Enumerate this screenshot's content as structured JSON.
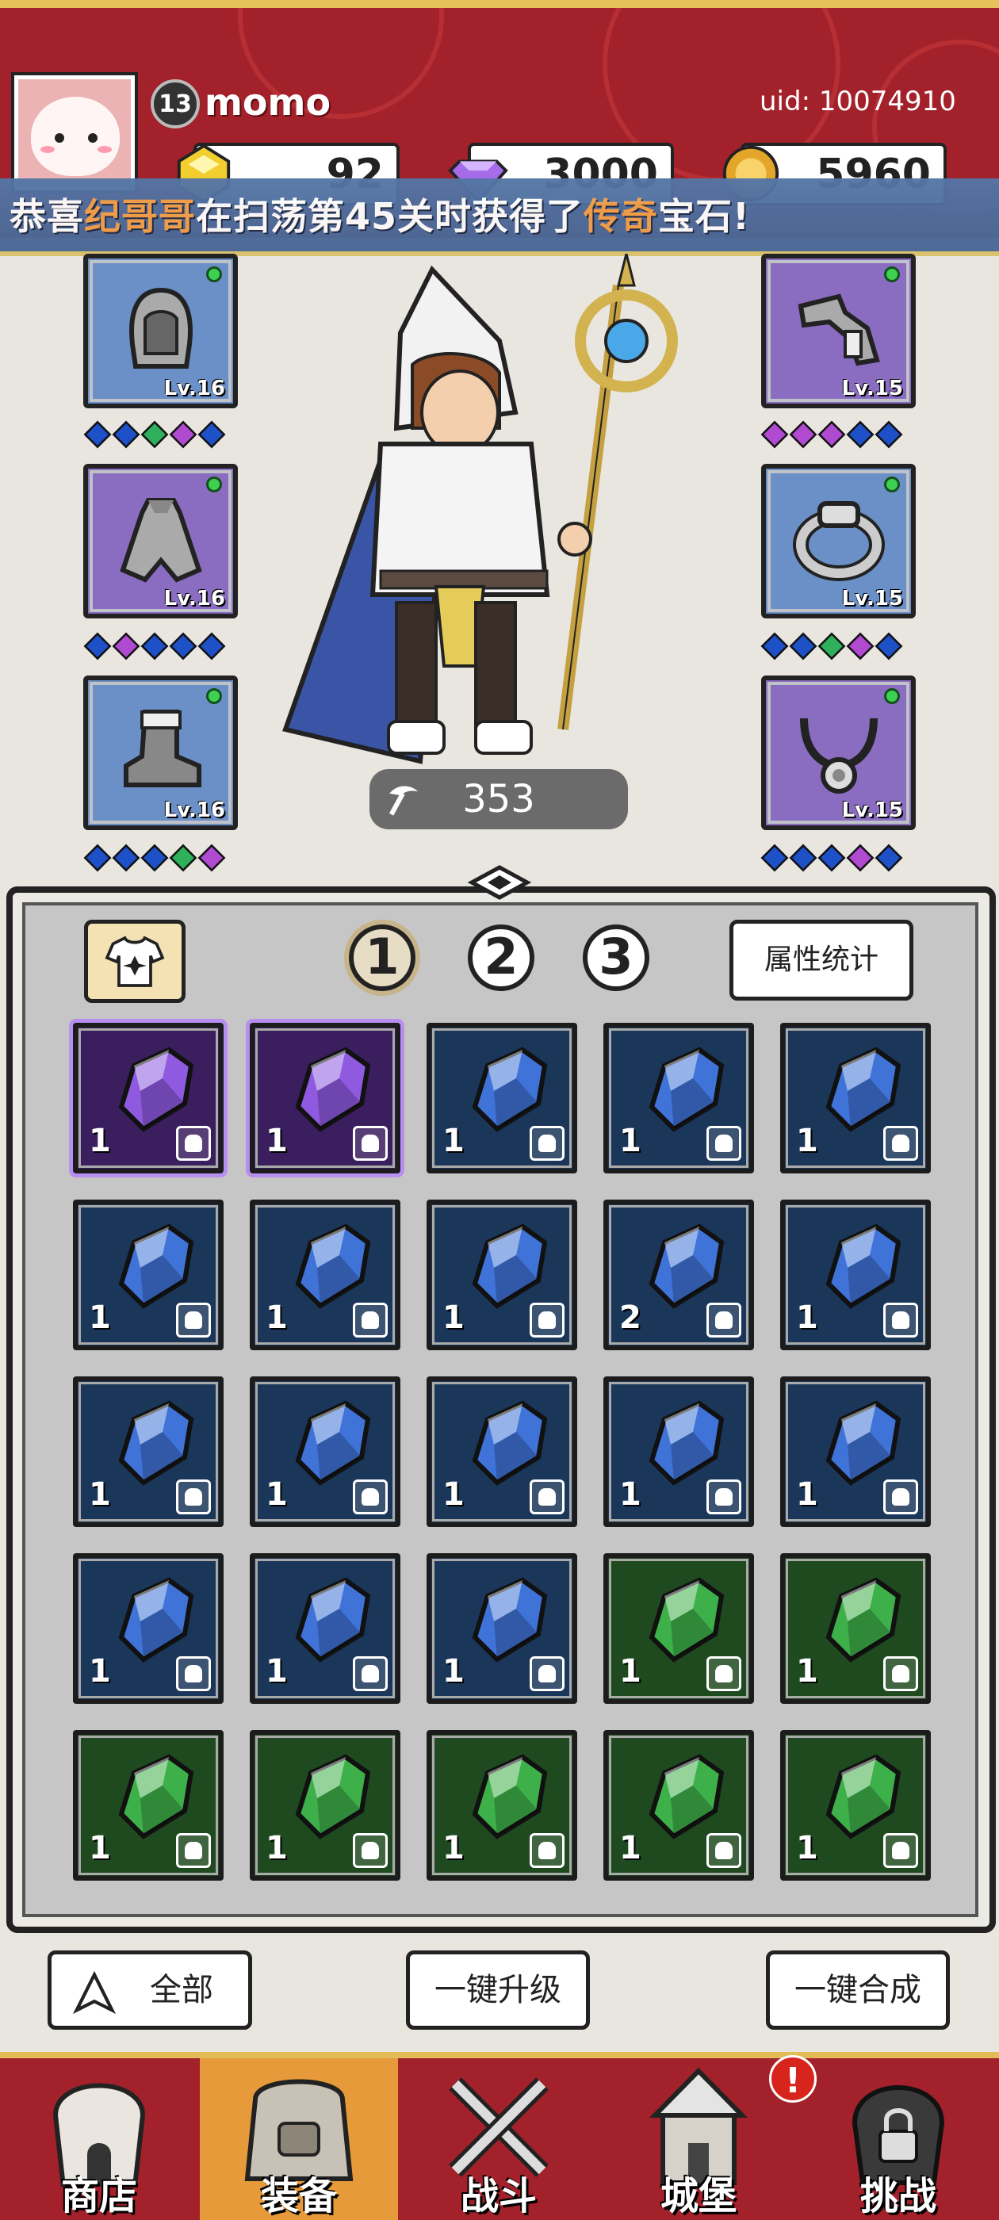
{
  "header": {
    "avatar_icon": "pink-blob-avatar",
    "level": "13",
    "username": "momo",
    "uid": "uid: 10074910",
    "resources": [
      {
        "icon": "gold-gem-icon",
        "value": "92",
        "color": "#f2cf2f"
      },
      {
        "icon": "purple-diamond-icon",
        "value": "3000",
        "color": "#a56be8"
      },
      {
        "icon": "gold-coin-icon",
        "value": "5960",
        "color": "#e3a52a"
      }
    ]
  },
  "marquee": {
    "part1": "恭喜",
    "player": "纪哥哥",
    "part2": "在扫荡第45关时获得了",
    "rarity": "传奇",
    "part3": "宝石!"
  },
  "equipment": {
    "left": [
      {
        "icon": "hood-icon",
        "level": "Lv.16",
        "rarity": "blue",
        "gems": [
          "#1e50c8",
          "#1e50c8",
          "#2fb05a",
          "#b04ad0",
          "#1e50c8"
        ]
      },
      {
        "icon": "cloak-icon",
        "level": "Lv.16",
        "rarity": "purple",
        "gems": [
          "#1e50c8",
          "#b04ad0",
          "#1e50c8",
          "#1e50c8",
          "#1e50c8"
        ]
      },
      {
        "icon": "boot-icon",
        "level": "Lv.16",
        "rarity": "blue",
        "gems": [
          "#1e50c8",
          "#1e50c8",
          "#1e50c8",
          "#2fb05a",
          "#b04ad0"
        ]
      }
    ],
    "right": [
      {
        "icon": "bracer-icon",
        "level": "Lv.15",
        "rarity": "purple",
        "gems": [
          "#b04ad0",
          "#b04ad0",
          "#b04ad0",
          "#1e50c8",
          "#1e50c8"
        ]
      },
      {
        "icon": "ring-icon",
        "level": "Lv.15",
        "rarity": "blue",
        "gems": [
          "#1e50c8",
          "#1e50c8",
          "#2fb05a",
          "#b04ad0",
          "#1e50c8"
        ]
      },
      {
        "icon": "necklace-icon",
        "level": "Lv.15",
        "rarity": "purple",
        "gems": [
          "#1e50c8",
          "#1e50c8",
          "#1e50c8",
          "#b04ad0",
          "#1e50c8"
        ]
      }
    ]
  },
  "hero": {
    "icon": "wizard-hero-icon",
    "power": "353",
    "power_icon": "pickaxe-icon"
  },
  "panel": {
    "outfit_icon": "tshirt-icon",
    "tabs": [
      "1",
      "2",
      "3"
    ],
    "active_tab": 0,
    "stats_label": "属性统计"
  },
  "gems": [
    {
      "color": "purple",
      "qty": "1",
      "type": "ring-type-icon"
    },
    {
      "color": "purple",
      "qty": "1",
      "type": "cloak-type-icon"
    },
    {
      "color": "blue",
      "qty": "1",
      "type": "ring-type-icon"
    },
    {
      "color": "blue",
      "qty": "1",
      "type": "ring-type-icon"
    },
    {
      "color": "blue",
      "qty": "1",
      "type": "cloak-type-icon"
    },
    {
      "color": "blue",
      "qty": "1",
      "type": "cloak-type-icon"
    },
    {
      "color": "blue",
      "qty": "1",
      "type": "cloak-type-icon"
    },
    {
      "color": "blue",
      "qty": "1",
      "type": "cloak-type-icon"
    },
    {
      "color": "blue",
      "qty": "2",
      "type": "boot-type-icon"
    },
    {
      "color": "blue",
      "qty": "1",
      "type": "boot-type-icon"
    },
    {
      "color": "blue",
      "qty": "1",
      "type": "boot-type-icon"
    },
    {
      "color": "blue",
      "qty": "1",
      "type": "bracer-type-icon"
    },
    {
      "color": "blue",
      "qty": "1",
      "type": "hood-type-icon"
    },
    {
      "color": "blue",
      "qty": "1",
      "type": "hood-type-icon"
    },
    {
      "color": "blue",
      "qty": "1",
      "type": "hood-type-icon"
    },
    {
      "color": "blue",
      "qty": "1",
      "type": "necklace-type-icon"
    },
    {
      "color": "blue",
      "qty": "1",
      "type": "necklace-type-icon"
    },
    {
      "color": "blue",
      "qty": "1",
      "type": "necklace-type-icon"
    },
    {
      "color": "green",
      "qty": "1",
      "type": "ring-type-icon"
    },
    {
      "color": "green",
      "qty": "1",
      "type": "ring-type-icon"
    },
    {
      "color": "green",
      "qty": "1",
      "type": "ring-type-icon"
    },
    {
      "color": "green",
      "qty": "1",
      "type": "cloak-type-icon"
    },
    {
      "color": "green",
      "qty": "1",
      "type": "boot-type-icon"
    },
    {
      "color": "green",
      "qty": "1",
      "type": "bracer-type-icon"
    },
    {
      "color": "green",
      "qty": "1",
      "type": "hood-type-icon"
    }
  ],
  "gem_colors": {
    "purple": "#8f5ae0",
    "blue": "#3f73d8",
    "green": "#3eb04a"
  },
  "actions": {
    "filter_label": "全部",
    "filter_icon": "triangle-up-icon",
    "upgrade_label": "一键升级",
    "merge_label": "一键合成"
  },
  "nav": [
    {
      "label": "商店",
      "icon": "shop-tower-icon"
    },
    {
      "label": "装备",
      "icon": "backpack-icon"
    },
    {
      "label": "战斗",
      "icon": "crossed-swords-icon"
    },
    {
      "label": "城堡",
      "icon": "castle-icon"
    },
    {
      "label": "挑战",
      "icon": "locked-helmet-icon"
    }
  ],
  "nav_active": 1,
  "nav_alert": "!"
}
